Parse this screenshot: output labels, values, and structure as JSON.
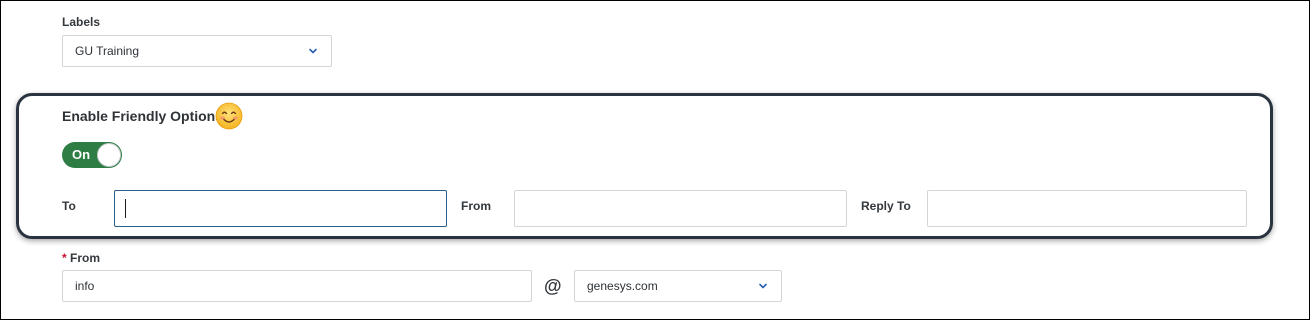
{
  "labels_section": {
    "label": "Labels",
    "selected": "GU Training"
  },
  "friendly_options": {
    "title": "Enable Friendly Options",
    "emoji_icon": "smiling-face-emoji",
    "toggle_label": "On",
    "to_label": "To",
    "to_value": "",
    "from_label": "From",
    "from_value": "",
    "reply_to_label": "Reply To",
    "reply_to_value": ""
  },
  "from_section": {
    "required_mark": "*",
    "label": "From",
    "local_part": "info",
    "at": "@",
    "domain_selected": "genesys.com"
  },
  "colors": {
    "toggle_on": "#2e7d45",
    "required": "#c8102e",
    "chevron": "#2b5fb0",
    "highlight_border": "#2a3340"
  }
}
